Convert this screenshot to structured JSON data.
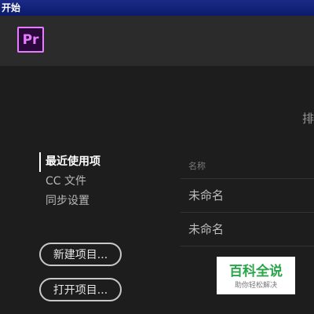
{
  "window": {
    "title": "开始"
  },
  "app": {
    "logo_text": "Pr",
    "brand_color": "#e77cff"
  },
  "sort": {
    "label": "排"
  },
  "nav": {
    "items": [
      {
        "label": "最近使用项",
        "active": true
      },
      {
        "label": "CC 文件",
        "active": false
      },
      {
        "label": "同步设置",
        "active": false
      }
    ]
  },
  "buttons": {
    "new_project": "新建项目...",
    "open_project": "打开项目..."
  },
  "recent": {
    "column_name": "名称",
    "rows": [
      {
        "name": "未命名"
      },
      {
        "name": "未命名"
      }
    ]
  },
  "watermark": {
    "main": "百科全说",
    "sub": "助你轻松解决"
  }
}
